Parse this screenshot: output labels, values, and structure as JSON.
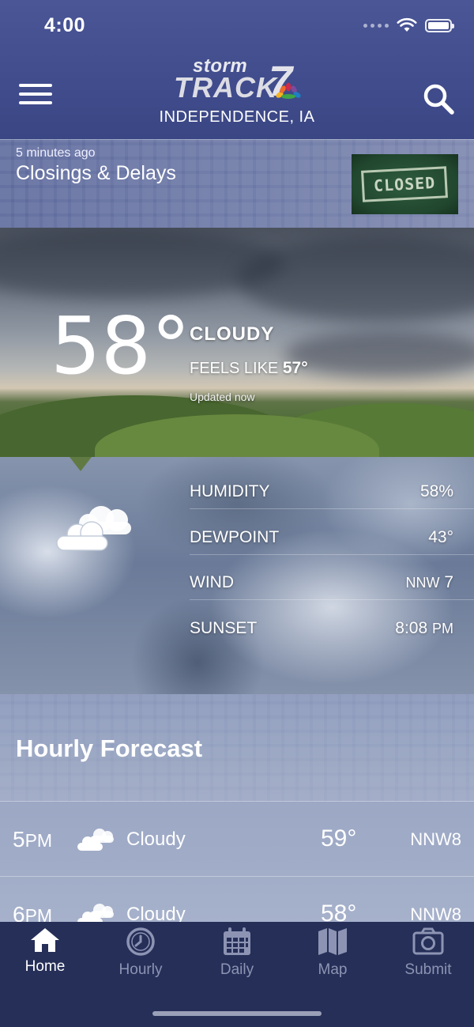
{
  "status_bar": {
    "time": "4:00"
  },
  "header": {
    "logo_storm": "storm",
    "logo_track": "TRACK",
    "logo_number": "7",
    "location": "INDEPENDENCE, IA",
    "menu_icon": "hamburger-menu-icon",
    "search_icon": "search-icon"
  },
  "closings": {
    "time_ago": "5 minutes ago",
    "title": "Closings & Delays",
    "thumbnail_text": "CLOSED"
  },
  "current": {
    "temperature": "58°",
    "condition": "CLOUDY",
    "feels_like_label": "FEELS LIKE",
    "feels_like_value": "57°",
    "updated": "Updated now"
  },
  "details": [
    {
      "label": "HUMIDITY",
      "value": "58%"
    },
    {
      "label": "DEWPOINT",
      "value": "43°"
    },
    {
      "label": "WIND",
      "value_dir": "NNW",
      "value_speed": "7"
    },
    {
      "label": "SUNSET",
      "value_time": "8:08",
      "value_ampm": "PM"
    }
  ],
  "hourly": {
    "title": "Hourly Forecast",
    "rows": [
      {
        "hour": "5",
        "ampm": "PM",
        "condition": "Cloudy",
        "temp": "59°",
        "wind": "NNW8"
      },
      {
        "hour": "6",
        "ampm": "PM",
        "condition": "Cloudy",
        "temp": "58°",
        "wind": "NNW8"
      }
    ]
  },
  "tabs": [
    {
      "label": "Home",
      "icon": "home-icon",
      "active": true
    },
    {
      "label": "Hourly",
      "icon": "clock-icon",
      "active": false
    },
    {
      "label": "Daily",
      "icon": "calendar-icon",
      "active": false
    },
    {
      "label": "Map",
      "icon": "map-icon",
      "active": false
    },
    {
      "label": "Submit",
      "icon": "camera-icon",
      "active": false
    }
  ],
  "colors": {
    "header_bg": "#4a5696",
    "tabbar_bg": "#252f58",
    "tab_inactive": "#8d94b3"
  }
}
